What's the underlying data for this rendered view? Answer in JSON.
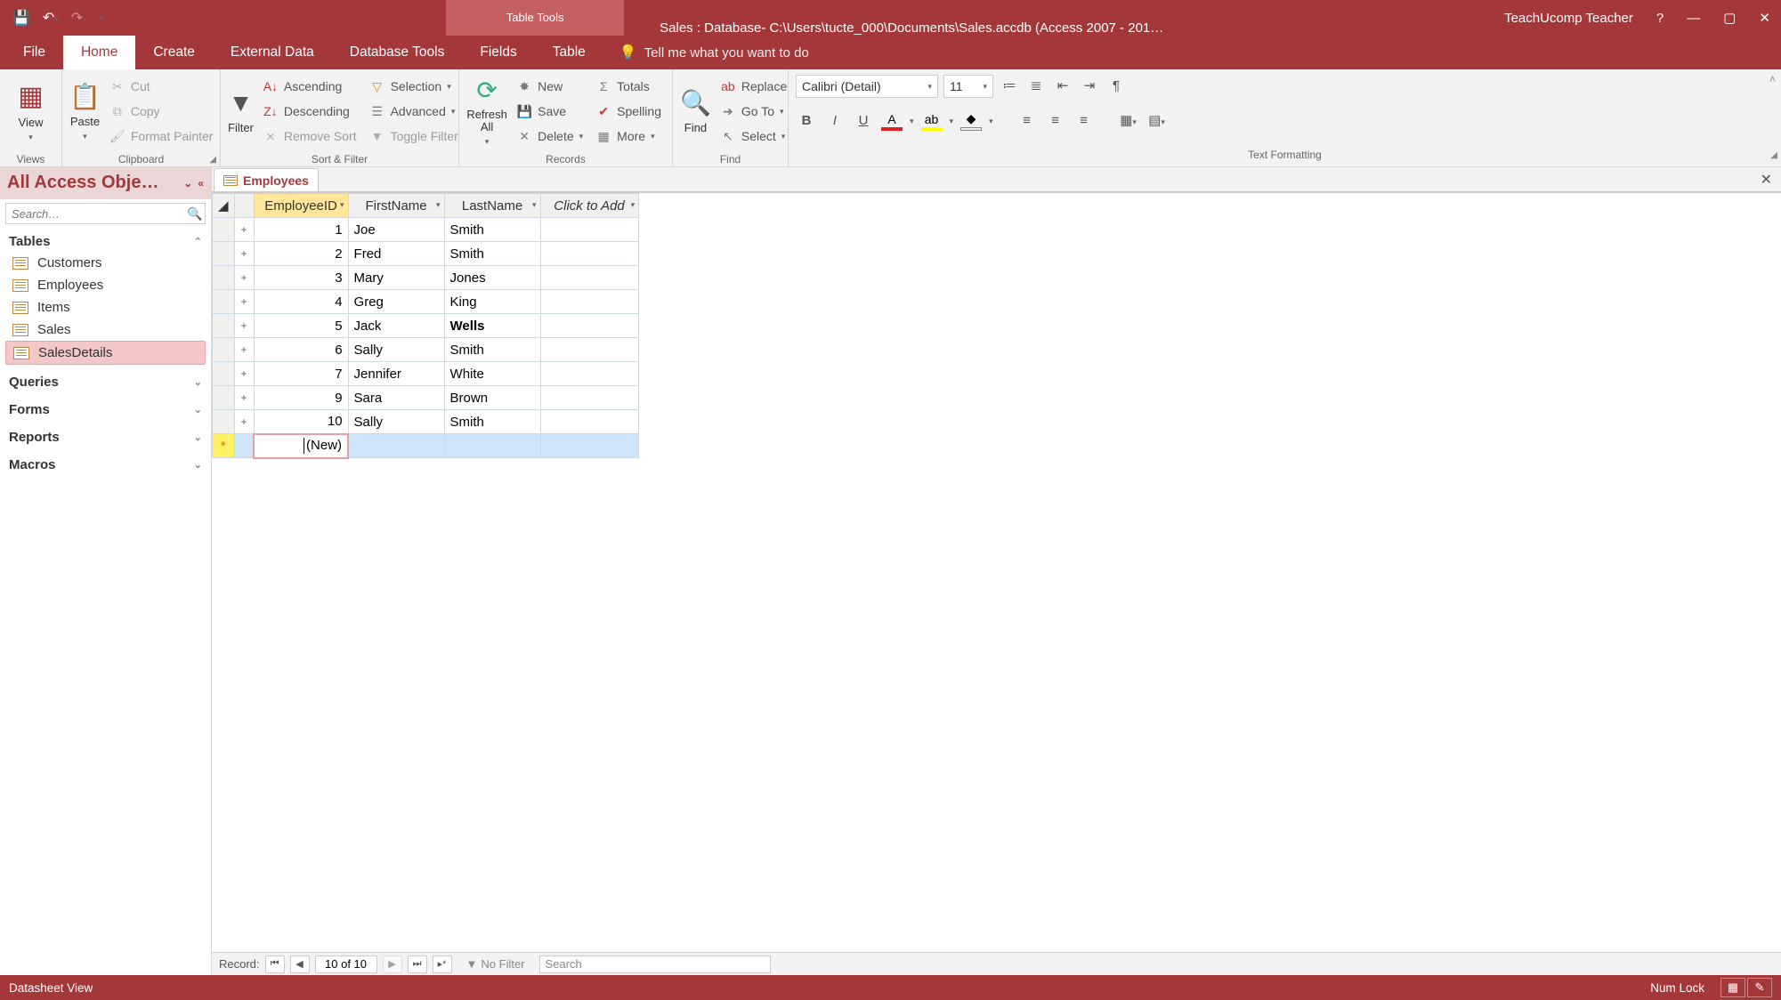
{
  "titlebar": {
    "context_label": "Table Tools",
    "title": "Sales : Database- C:\\Users\\tucte_000\\Documents\\Sales.accdb (Access 2007 - 201…",
    "user": "TeachUcomp Teacher"
  },
  "tabs": {
    "file": "File",
    "home": "Home",
    "create": "Create",
    "external": "External Data",
    "dbtools": "Database Tools",
    "fields": "Fields",
    "table": "Table",
    "tellme": "Tell me what you want to do"
  },
  "ribbon": {
    "views": {
      "view": "View",
      "label": "Views"
    },
    "clipboard": {
      "paste": "Paste",
      "cut": "Cut",
      "copy": "Copy",
      "painter": "Format Painter",
      "label": "Clipboard"
    },
    "sort": {
      "filter": "Filter",
      "asc": "Ascending",
      "desc": "Descending",
      "remove": "Remove Sort",
      "selection": "Selection",
      "advanced": "Advanced",
      "toggle": "Toggle Filter",
      "label": "Sort & Filter"
    },
    "records": {
      "refresh": "Refresh\nAll",
      "new": "New",
      "save": "Save",
      "delete": "Delete",
      "totals": "Totals",
      "spelling": "Spelling",
      "more": "More",
      "label": "Records"
    },
    "find": {
      "find": "Find",
      "replace": "Replace",
      "goto": "Go To",
      "select": "Select",
      "label": "Find"
    },
    "text": {
      "font": "Calibri (Detail)",
      "size": "11",
      "label": "Text Formatting"
    }
  },
  "nav": {
    "header": "All Access Obje…",
    "search_placeholder": "Search…",
    "groups": {
      "tables": "Tables",
      "queries": "Queries",
      "forms": "Forms",
      "reports": "Reports",
      "macros": "Macros"
    },
    "tables": [
      "Customers",
      "Employees",
      "Items",
      "Sales",
      "SalesDetails"
    ],
    "selected": "SalesDetails"
  },
  "doc": {
    "tab": "Employees",
    "columns": [
      "EmployeeID",
      "FirstName",
      "LastName"
    ],
    "addcol": "Click to Add",
    "rows": [
      {
        "id": "1",
        "fn": "Joe",
        "ln": "Smith",
        "bold": false
      },
      {
        "id": "2",
        "fn": "Fred",
        "ln": "Smith",
        "bold": false
      },
      {
        "id": "3",
        "fn": "Mary",
        "ln": "Jones",
        "bold": false
      },
      {
        "id": "4",
        "fn": "Greg",
        "ln": "King",
        "bold": false
      },
      {
        "id": "5",
        "fn": "Jack",
        "ln": "Wells",
        "bold": true
      },
      {
        "id": "6",
        "fn": "Sally",
        "ln": "Smith",
        "bold": false
      },
      {
        "id": "7",
        "fn": "Jennifer",
        "ln": "White",
        "bold": false
      },
      {
        "id": "9",
        "fn": "Sara",
        "ln": "Brown",
        "bold": false
      },
      {
        "id": "10",
        "fn": "Sally",
        "ln": "Smith",
        "bold": false
      }
    ],
    "newrow": "(New)"
  },
  "recnav": {
    "label": "Record:",
    "pos": "10 of 10",
    "nofilter": "No Filter",
    "search": "Search"
  },
  "status": {
    "left": "Datasheet View",
    "numlock": "Num Lock"
  }
}
